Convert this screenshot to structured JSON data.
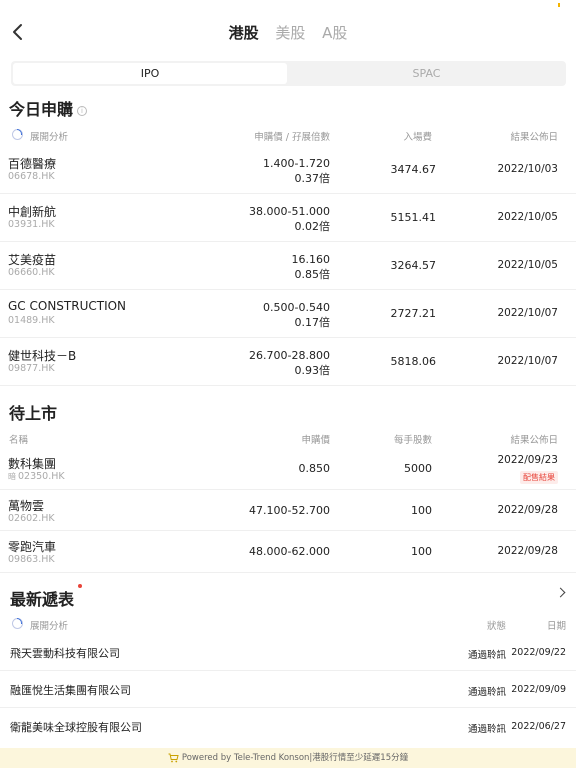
{
  "header": {
    "tabs": [
      {
        "label": "港股",
        "active": true
      },
      {
        "label": "美股",
        "active": false
      },
      {
        "label": "A股",
        "active": false
      }
    ]
  },
  "segment": {
    "ipo": "IPO",
    "spac": "SPAC"
  },
  "today": {
    "title": "今日申購",
    "expand": "展開分析",
    "cols": {
      "price": "申購價 / 孖展倍數",
      "fee": "入場費",
      "date": "結果公佈日"
    },
    "rows": [
      {
        "name": "百德醫療",
        "code": "06678.HK",
        "price": "1.400-1.720",
        "mult": "0.37倍",
        "fee": "3474.67",
        "date": "2022/10/03"
      },
      {
        "name": "中創新航",
        "code": "03931.HK",
        "price": "38.000-51.000",
        "mult": "0.02倍",
        "fee": "5151.41",
        "date": "2022/10/05"
      },
      {
        "name": "艾美疫苗",
        "code": "06660.HK",
        "price": "16.160",
        "mult": "0.85倍",
        "fee": "3264.57",
        "date": "2022/10/05"
      },
      {
        "name": "GC CONSTRUCTION",
        "code": "01489.HK",
        "price": "0.500-0.540",
        "mult": "0.17倍",
        "fee": "2727.21",
        "date": "2022/10/07"
      },
      {
        "name": "健世科技－B",
        "code": "09877.HK",
        "price": "26.700-28.800",
        "mult": "0.93倍",
        "fee": "5818.06",
        "date": "2022/10/07"
      }
    ]
  },
  "pending": {
    "title": "待上市",
    "cols": {
      "name": "名稱",
      "price": "申購價",
      "lot": "每手股數",
      "date": "結果公佈日"
    },
    "rows": [
      {
        "name": "數科集團",
        "prefix": "暗",
        "code": "02350.HK",
        "price": "0.850",
        "lot": "5000",
        "date": "2022/09/23",
        "badge": "配售結果"
      },
      {
        "name": "萬物雲",
        "prefix": "",
        "code": "02602.HK",
        "price": "47.100-52.700",
        "lot": "100",
        "date": "2022/09/28",
        "badge": ""
      },
      {
        "name": "零跑汽車",
        "prefix": "",
        "code": "09863.HK",
        "price": "48.000-62.000",
        "lot": "100",
        "date": "2022/09/28",
        "badge": ""
      }
    ]
  },
  "filings": {
    "title": "最新遞表",
    "expand": "展開分析",
    "cols": {
      "status": "狀態",
      "date": "日期"
    },
    "rows": [
      {
        "name": "飛天雲動科技有限公司",
        "status": "通過聆訊",
        "date": "2022/09/22"
      },
      {
        "name": "融匯悅生活集團有限公司",
        "status": "通過聆訊",
        "date": "2022/09/09"
      },
      {
        "name": "衛龍美味全球控股有限公司",
        "status": "通過聆訊",
        "date": "2022/06/27"
      }
    ]
  },
  "footer": {
    "text": "Powered by Tele-Trend Konson|港股行情至少延遲15分鐘"
  },
  "colors": {
    "accent": "#3d6fd8",
    "red": "#e8443a",
    "footer_bg": "#fcf6dc"
  }
}
